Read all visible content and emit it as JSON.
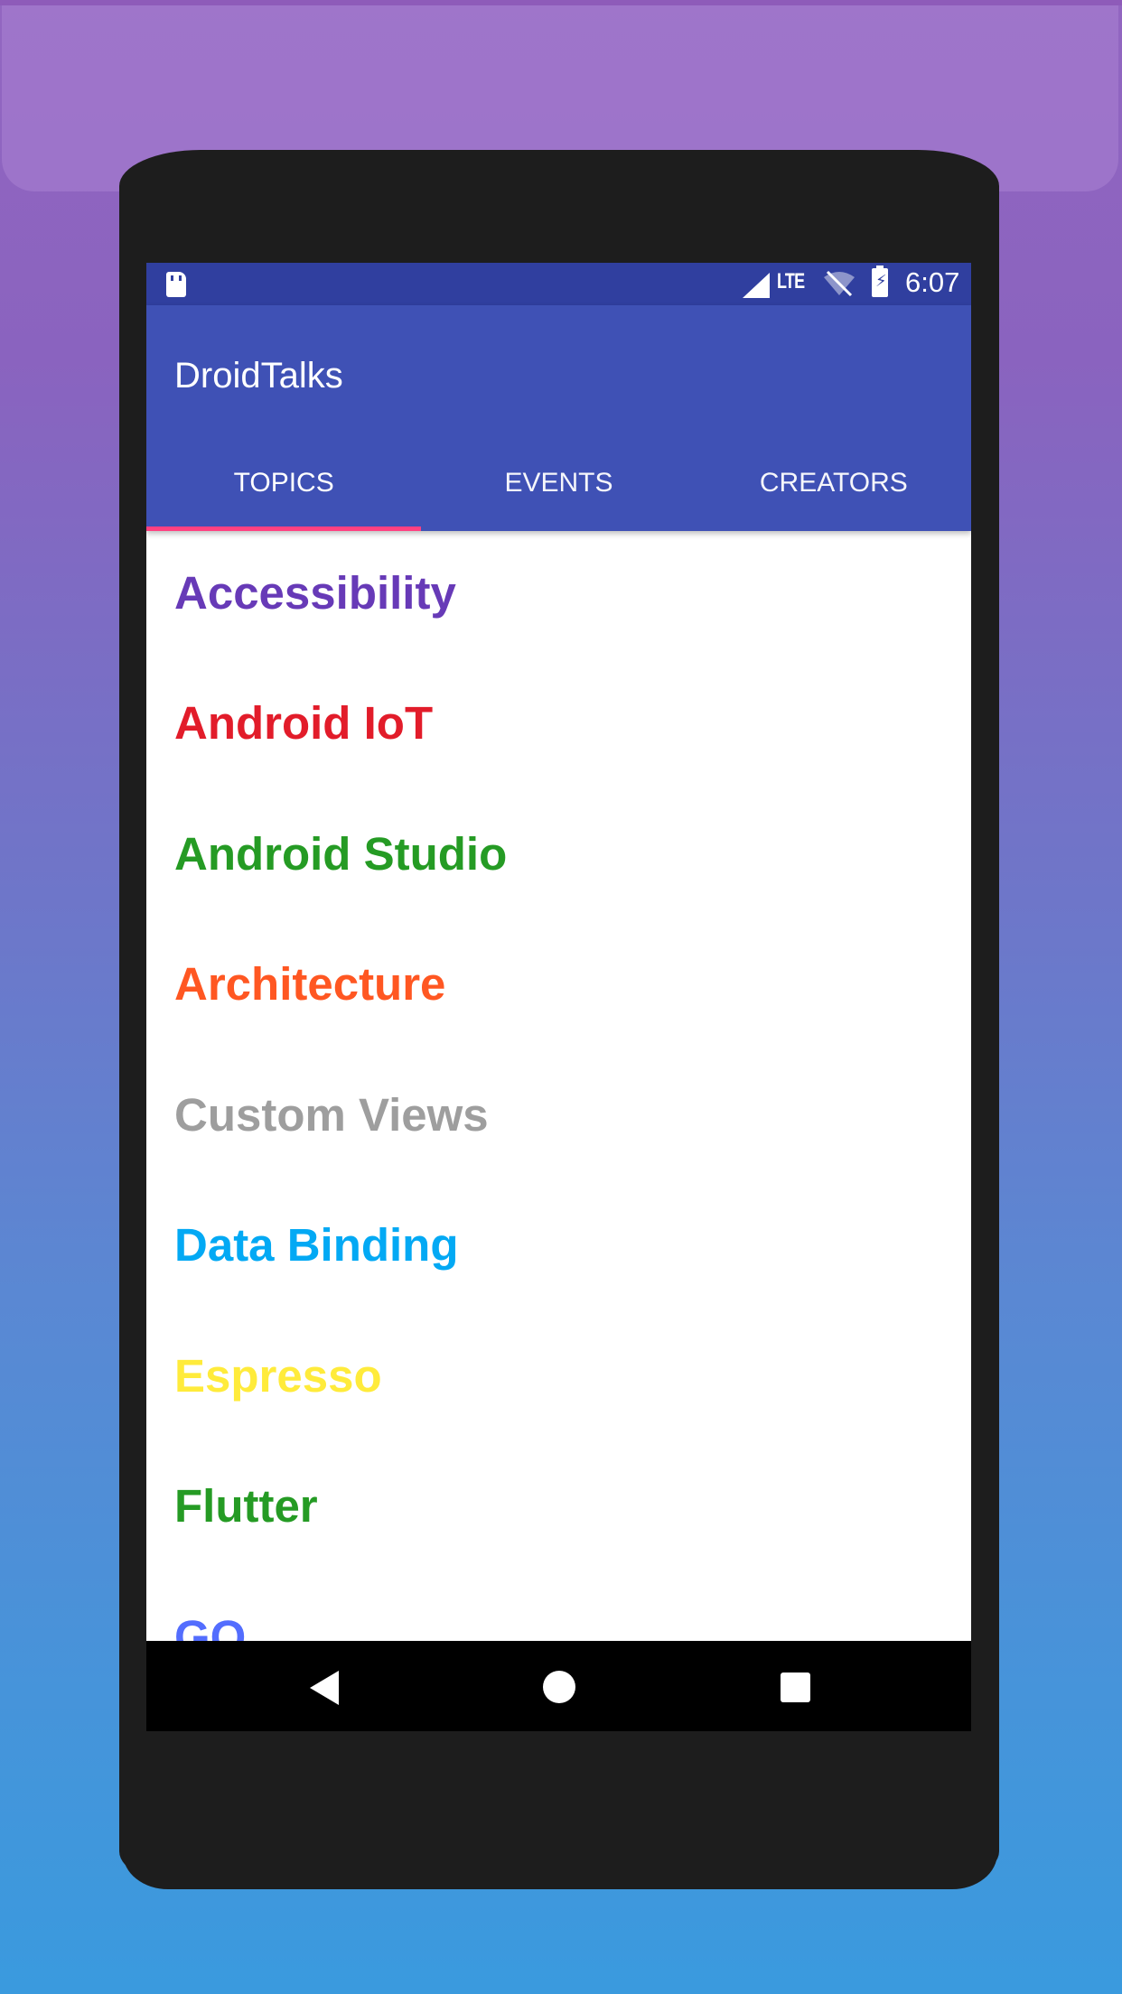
{
  "status_bar": {
    "network": "LTE",
    "time": "6:07",
    "icons": [
      "sd-card-icon",
      "cell-signal-icon",
      "wifi-off-icon",
      "battery-charging-icon"
    ]
  },
  "app_bar": {
    "title": "DroidTalks",
    "color": "#3f51b5",
    "status_color": "#303f9f",
    "accent": "#ff4081"
  },
  "tabs": [
    {
      "label": "TOPICS",
      "selected": true
    },
    {
      "label": "EVENTS",
      "selected": false
    },
    {
      "label": "CREATORS",
      "selected": false
    }
  ],
  "topics": [
    {
      "label": "Accessibility",
      "color": "#673ab7"
    },
    {
      "label": "Android IoT",
      "color": "#e21c2a"
    },
    {
      "label": "Android Studio",
      "color": "#259b24"
    },
    {
      "label": "Architecture",
      "color": "#ff5722"
    },
    {
      "label": "Custom Views",
      "color": "#9e9e9e"
    },
    {
      "label": "Data Binding",
      "color": "#03a9f4"
    },
    {
      "label": "Espresso",
      "color": "#ffeb3b"
    },
    {
      "label": "Flutter",
      "color": "#259b24"
    },
    {
      "label": "GO",
      "color": "#536dfe"
    }
  ],
  "nav_bar": {
    "icons": [
      "back-icon",
      "home-icon",
      "recents-icon"
    ]
  }
}
